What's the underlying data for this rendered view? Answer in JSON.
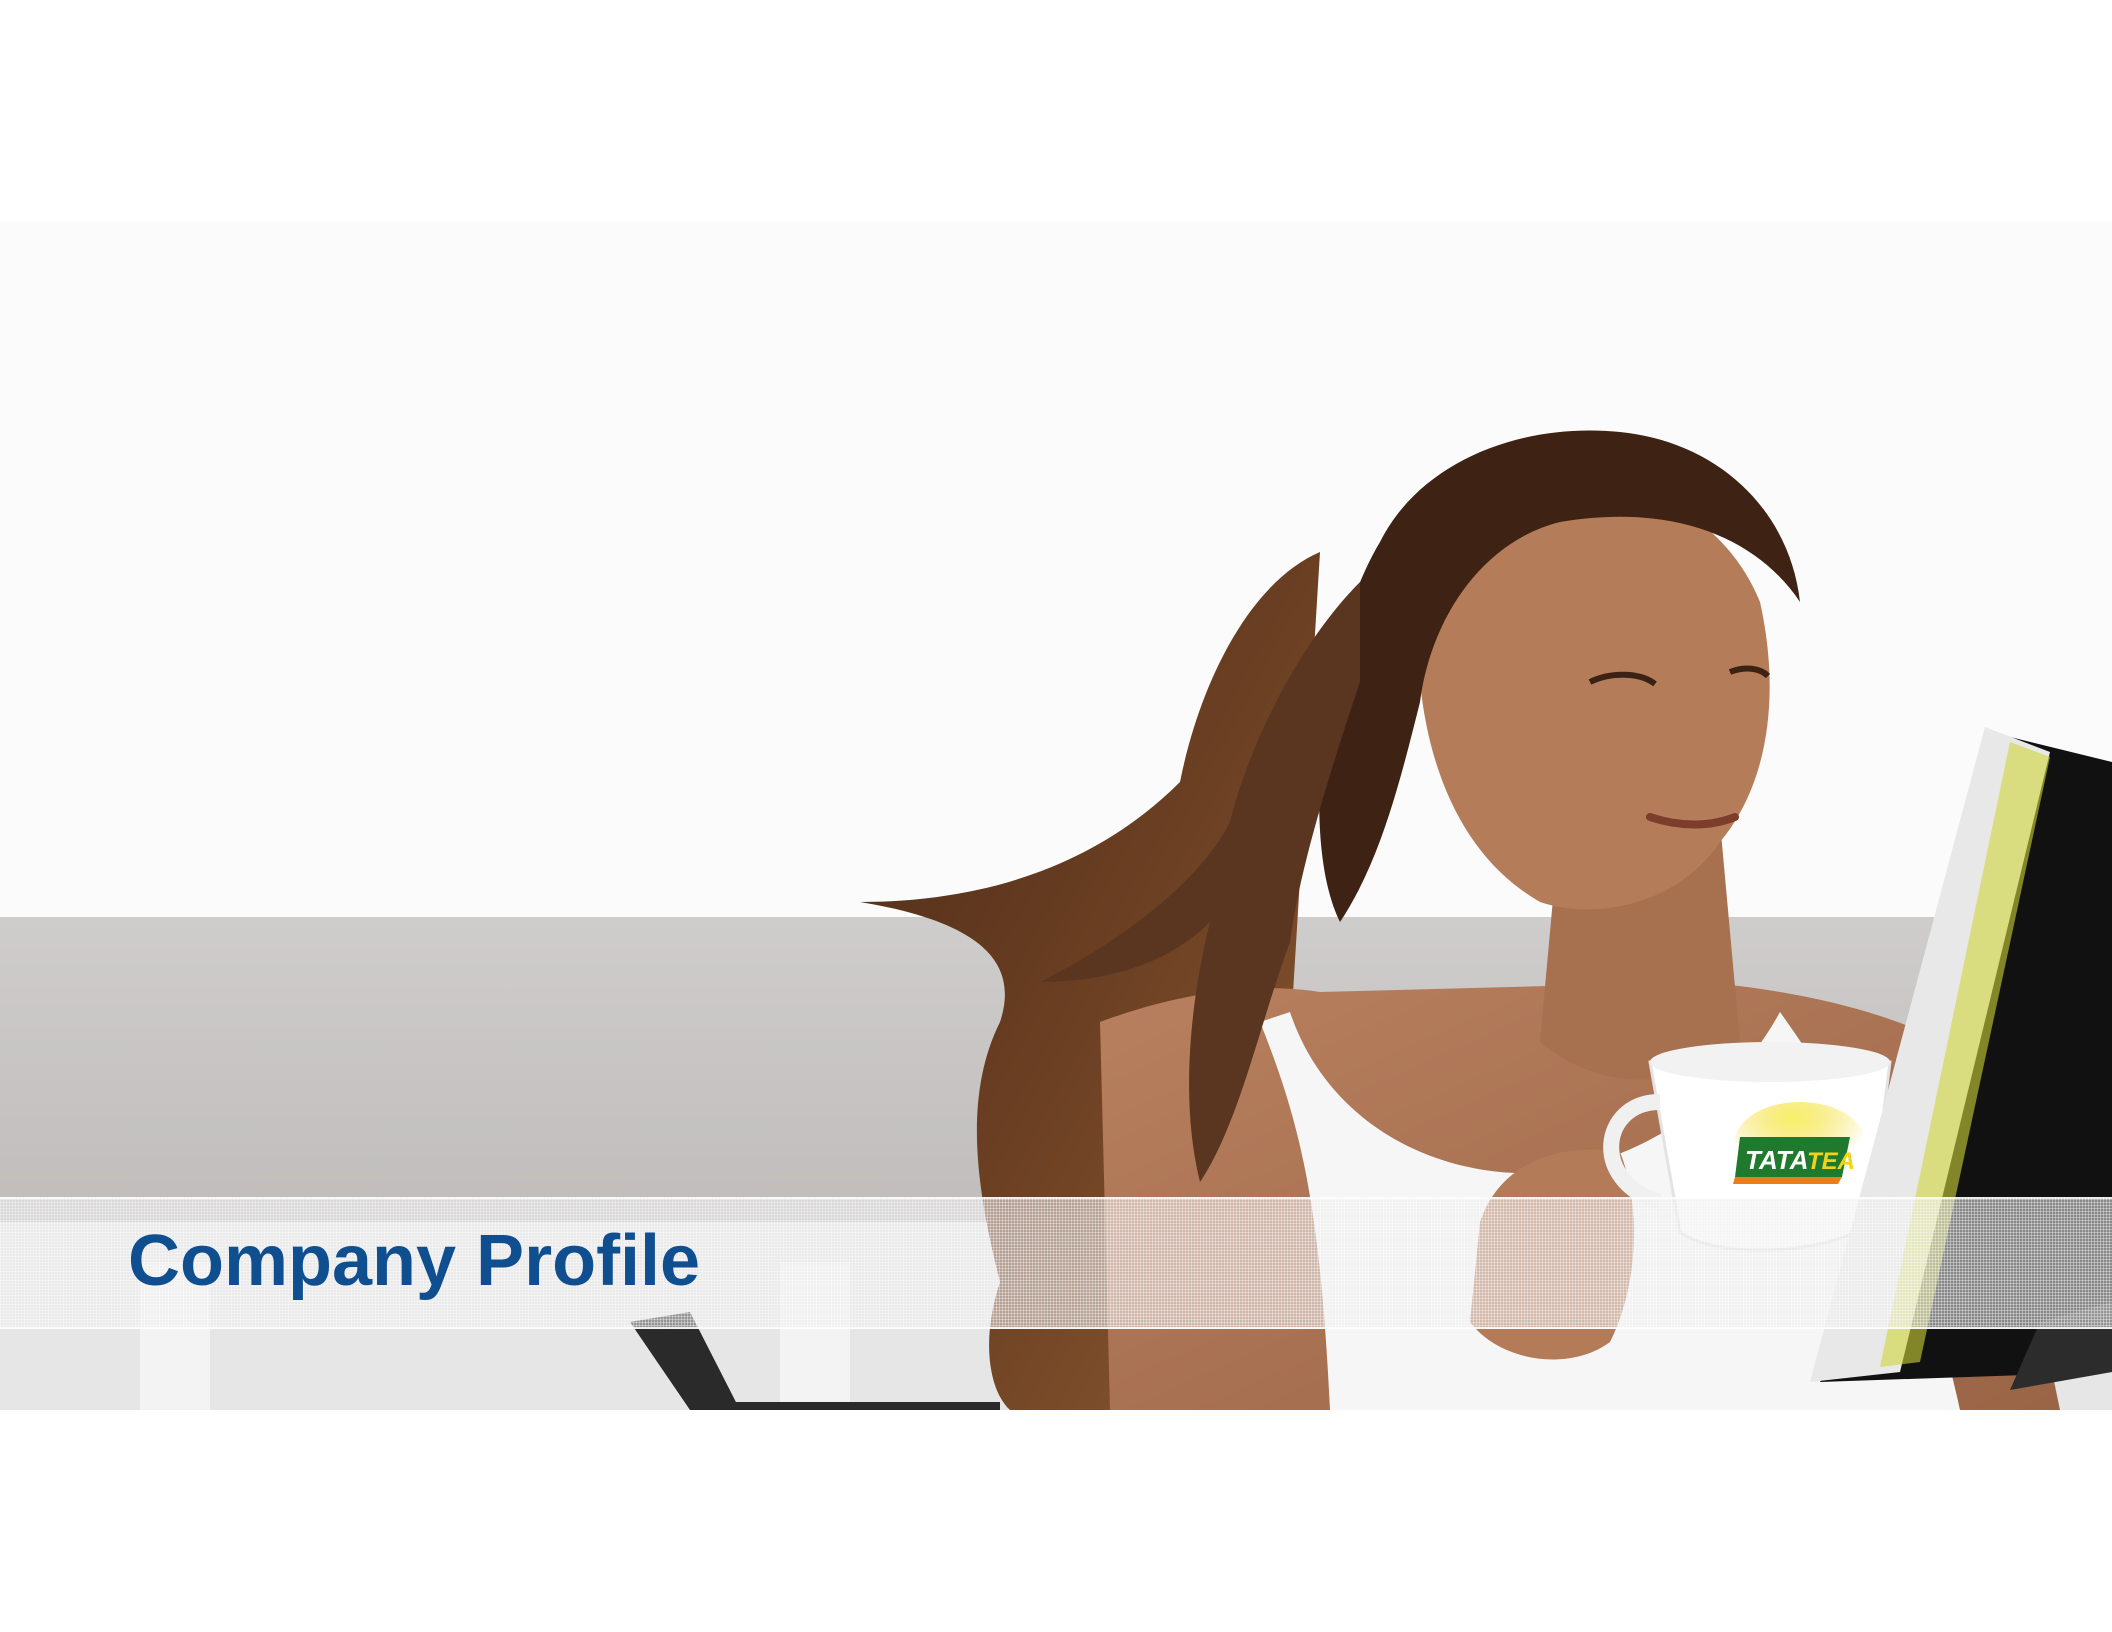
{
  "slide": {
    "title": "Company Profile",
    "title_color": "#0f4f8f",
    "background_color": "#ffffff"
  },
  "photo": {
    "subject": "woman-reading-with-tea-cup",
    "logo": {
      "name": "tata-tea-logo",
      "word1": "TATA",
      "word2": "TEA",
      "colors": {
        "green": "#1f7a2e",
        "yellow": "#f2d21b",
        "orange": "#e87e1c"
      }
    }
  }
}
